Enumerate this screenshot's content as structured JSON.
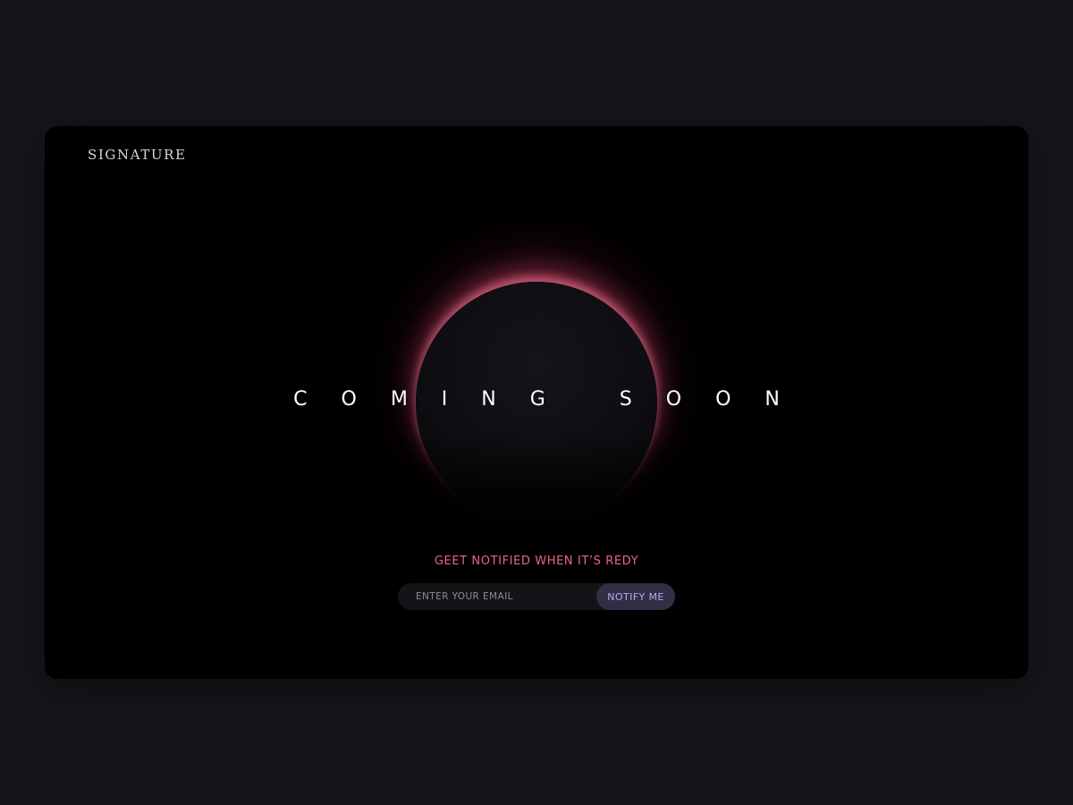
{
  "brand": {
    "logo": "SIGNATURE"
  },
  "hero": {
    "headline": "COMING SOON"
  },
  "signup": {
    "label": "GEET NOTIFIED WHEN IT’S REDY",
    "email_placeholder": "ENTER YOUR EMAIL",
    "button_label": "NOTIFY ME"
  },
  "colors": {
    "page_background": "#15151a",
    "card_background": "#000000",
    "accent_pink": "#e8677d",
    "button_background": "#322e45",
    "button_text": "#b8adf0"
  }
}
